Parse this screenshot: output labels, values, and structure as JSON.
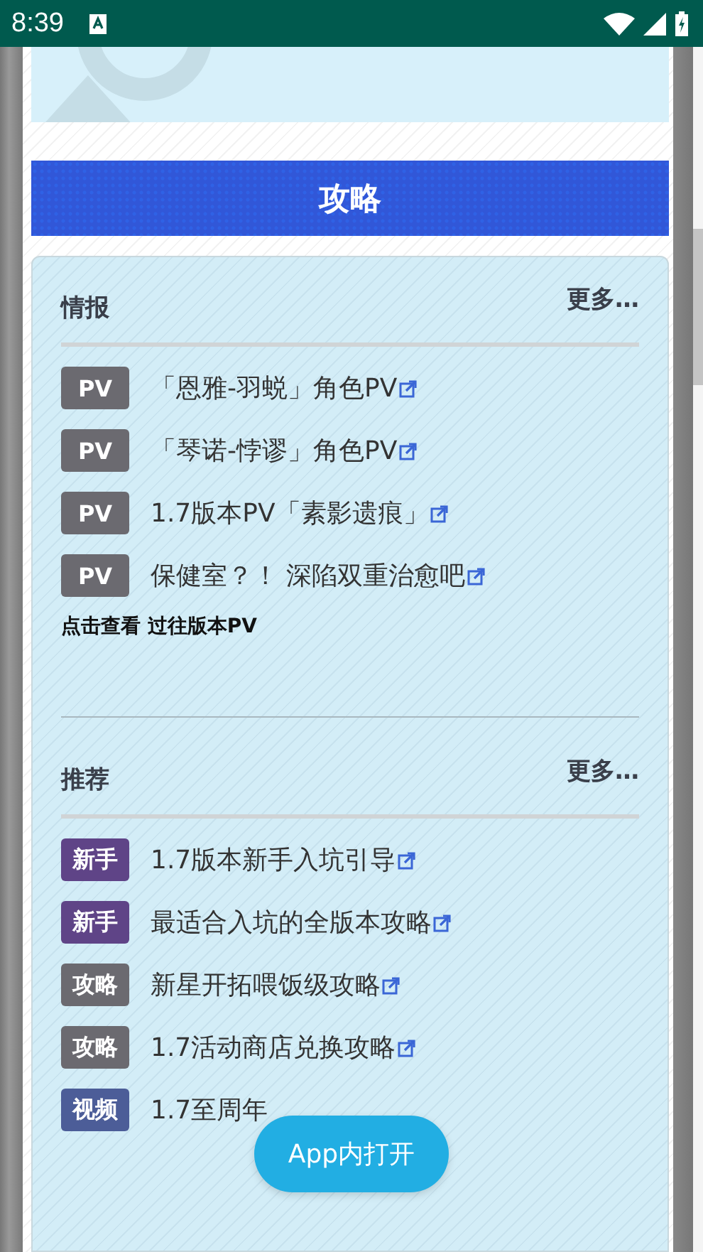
{
  "status_bar": {
    "time": "8:39"
  },
  "section_title": "攻略",
  "groups": [
    {
      "title": "情报",
      "more": "更多…",
      "items": [
        {
          "tag": "PV",
          "color": "#6b6a70",
          "text": "「恩雅-羽蜕」角色PV"
        },
        {
          "tag": "PV",
          "color": "#6b6a70",
          "text": "「琴诺-悖谬」角色PV"
        },
        {
          "tag": "PV",
          "color": "#6b6a70",
          "text": "1.7版本PV「素影遗痕」"
        },
        {
          "tag": "PV",
          "color": "#6b6a70",
          "text": "保健室？！ 深陷双重治愈吧"
        }
      ],
      "footer": "点击查看 过往版本PV"
    },
    {
      "title": "推荐",
      "more": "更多…",
      "items": [
        {
          "tag": "新手",
          "color": "#5f4487",
          "text": "1.7版本新手入坑引导"
        },
        {
          "tag": "新手",
          "color": "#5f4487",
          "text": "最适合入坑的全版本攻略"
        },
        {
          "tag": "攻略",
          "color": "#6b6a70",
          "text": "新星开拓喂饭级攻略"
        },
        {
          "tag": "攻略",
          "color": "#6b6a70",
          "text": "1.7活动商店兑换攻略"
        },
        {
          "tag": "视频",
          "color": "#4c5d98",
          "text": "1.7至周年"
        }
      ]
    }
  ],
  "open_in_app": "App内打开"
}
